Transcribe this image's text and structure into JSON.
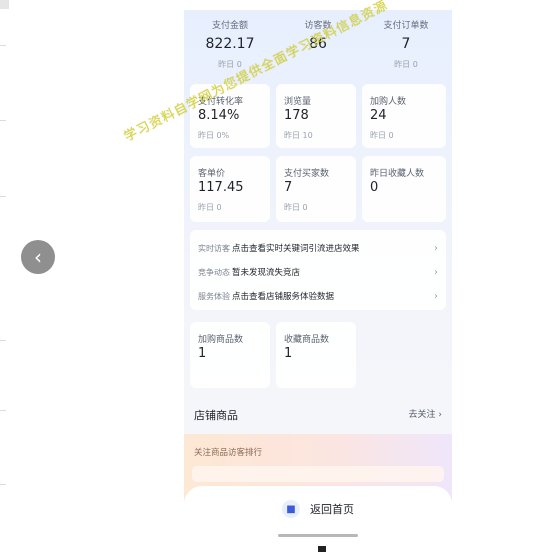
{
  "top_stats": [
    {
      "label": "支付金额",
      "value": "822.17",
      "yesterday": "昨日 0"
    },
    {
      "label": "访客数",
      "value": "86",
      "yesterday": ""
    },
    {
      "label": "支付订单数",
      "value": "7",
      "yesterday": "昨日 0"
    }
  ],
  "metrics": [
    {
      "label": "支付转化率",
      "value": "8.14%",
      "yesterday": "昨日 0%"
    },
    {
      "label": "浏览量",
      "value": "178",
      "yesterday": "昨日 10"
    },
    {
      "label": "加购人数",
      "value": "24",
      "yesterday": "昨日 0"
    },
    {
      "label": "客单价",
      "value": "117.45",
      "yesterday": "昨日 0"
    },
    {
      "label": "支付买家数",
      "value": "7",
      "yesterday": "昨日 0"
    },
    {
      "label": "昨日收藏人数",
      "value": "0",
      "yesterday": ""
    }
  ],
  "insights": [
    {
      "tag": "实时访客",
      "text": "点击查看实时关键词引流进店效果"
    },
    {
      "tag": "竞争动态",
      "text": "暂未发现流失竞店"
    },
    {
      "tag": "服务体验",
      "text": "点击查看店铺服务体验数据"
    }
  ],
  "goods_metrics": [
    {
      "label": "加购商品数",
      "value": "1"
    },
    {
      "label": "收藏商品数",
      "value": "1"
    }
  ],
  "section": {
    "title": "店铺商品",
    "link": "去关注 ›"
  },
  "ranking": {
    "title": "关注商品访客排行"
  },
  "home": {
    "label": "返回首页"
  },
  "watermark": "学习资料自学网为您提供全面学习资料信息资源",
  "icons": {
    "back": "chevron-left-icon",
    "chevron": "chevron-right-icon",
    "home": "home-icon"
  },
  "colors": {
    "accent": "#3b5bdb",
    "watermark": "#d8d63a"
  }
}
